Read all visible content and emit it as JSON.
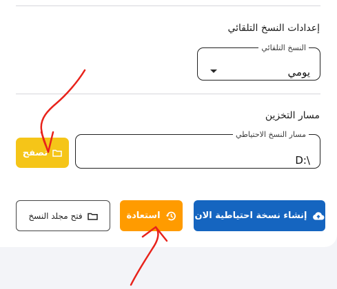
{
  "auto_backup": {
    "section_title": "إعدادات النسخ التلقائي",
    "field_label": "النسخ التلقائي",
    "selected_value": "يومي"
  },
  "storage": {
    "section_title": "مسار التخزين",
    "field_label": "مسار النسخ الاحتياطي",
    "path_value": "D:\\",
    "browse_label": "تصفح"
  },
  "actions": {
    "create_backup_label": "إنشاء نسخة احتياطية الان",
    "restore_label": "استعادة",
    "open_folder_label": "فتح مجلد النسخ"
  },
  "colors": {
    "browse_button": "#f5c518",
    "restore_button": "#ff9b00",
    "create_button": "#1565c0",
    "annotation_arrows": "#e8231b"
  },
  "icons": {
    "browse": "folder-icon",
    "open_folder": "folder-icon",
    "restore": "history-icon",
    "create_backup": "cloud-upload-icon",
    "dropdown": "caret-down-icon"
  }
}
